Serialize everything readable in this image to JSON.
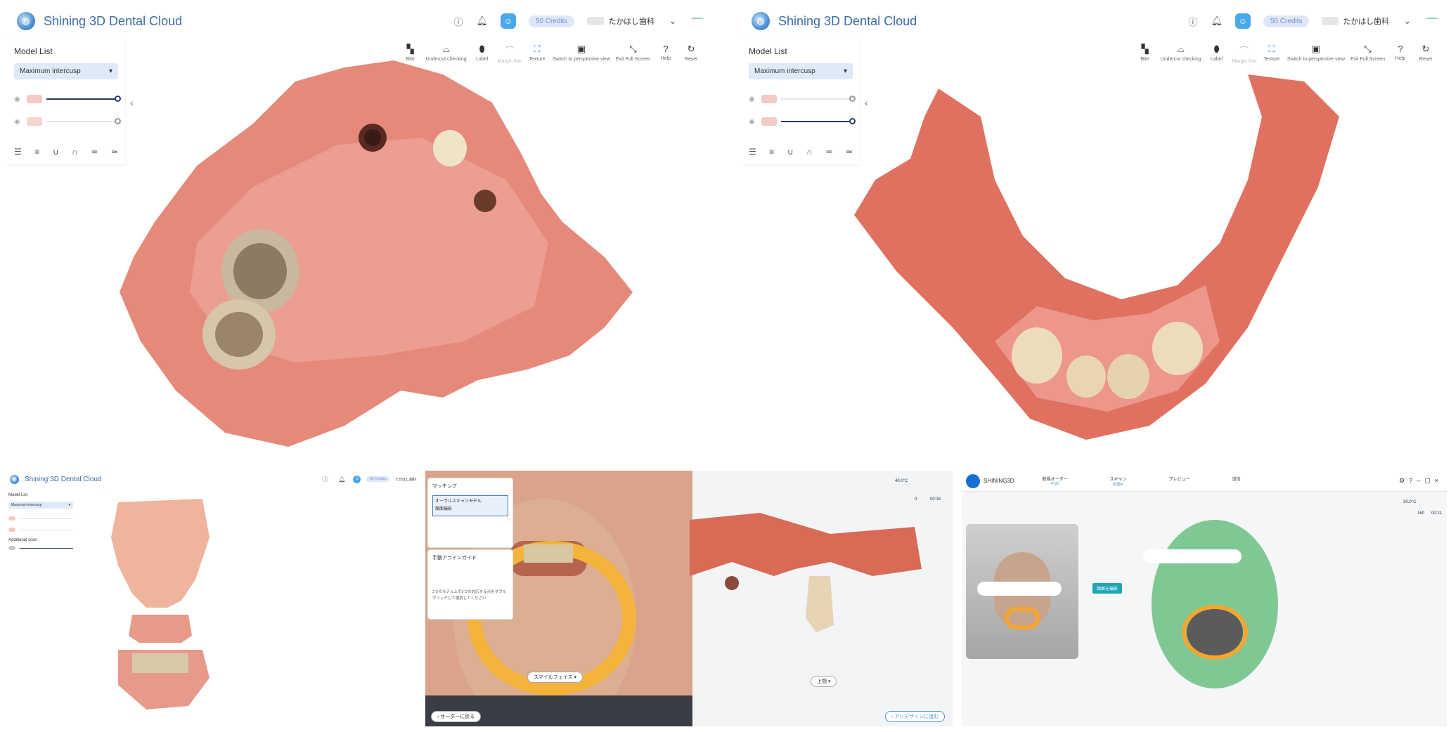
{
  "app": {
    "title": "Shining 3D Dental Cloud",
    "credits": "50 Credits",
    "clinic": "たかはし歯科"
  },
  "side": {
    "title": "Model List",
    "select": "Maximum intercusp"
  },
  "toolbar": {
    "items": [
      "Bite",
      "Undercut checking",
      "Label",
      "Margin line",
      "Texture",
      "Switch to perspective view",
      "Exit Full Screen",
      "Help",
      "Reset"
    ]
  },
  "p3": {
    "additional": "Additional scan"
  },
  "p4": {
    "match_title": "マッチング",
    "match_items": [
      "オーラルスキャンモデル",
      "顔面撮影"
    ],
    "guide_title": "手動アラインガイド",
    "guide_desc": "2つのモデル上で3つの対応する点をダブルクリックして選択してください",
    "face_label": "スマイルフェイス",
    "jaw_label": "上顎",
    "back": "オーダーに戻る",
    "next": "アリデザインに進む",
    "temp": "40.0°C",
    "count": "0",
    "timer": "00:18"
  },
  "p5": {
    "brand": "SHINING3D",
    "steps": [
      {
        "label": "新規オーダー",
        "sub": "4732"
      },
      {
        "label": "スキャン",
        "sub": "処理中"
      },
      {
        "label": "プレビュー",
        "sub": "-"
      },
      {
        "label": "送信",
        "sub": "-"
      }
    ],
    "btn": "顔面を撮影",
    "temp": "30.0°C",
    "count": "160",
    "timer": "00:21"
  },
  "colors": {
    "brand": "#3b6ea8",
    "accent": "#4a8fd4",
    "teal": "#1fa6b8",
    "gum": "#e07a6a"
  }
}
